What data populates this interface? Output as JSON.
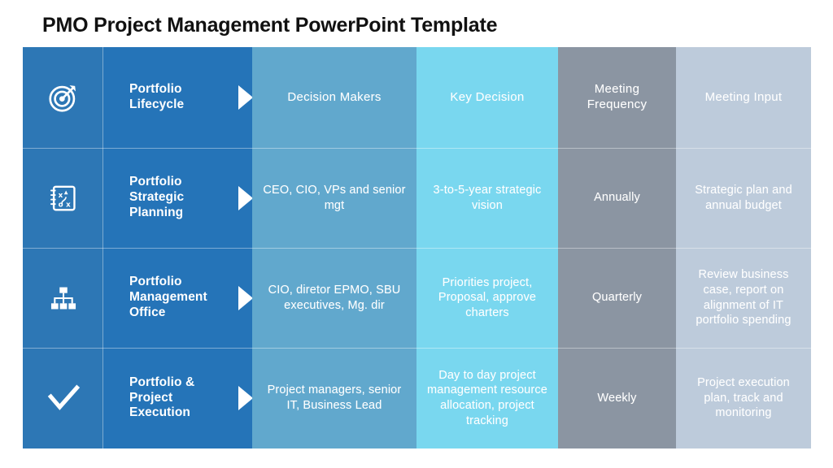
{
  "slide": {
    "title": "PMO Project Management PowerPoint Template"
  },
  "colors": {
    "icon_column": "#2d77b5",
    "stage_column": "#2574b8",
    "column_3": "#61a8cd",
    "column_4": "#79d7ef",
    "column_5": "#8b95a2",
    "column_6": "#bdcbdb",
    "arrow": "#ffffff",
    "title_text": "#111111",
    "cell_text": "#ffffff"
  },
  "matrix": {
    "columns": [
      {
        "key": "icon",
        "header": ""
      },
      {
        "key": "stage",
        "header": "Portfolio Lifecycle"
      },
      {
        "key": "c3",
        "header": "Decision Makers"
      },
      {
        "key": "c4",
        "header": "Key Decision"
      },
      {
        "key": "c5",
        "header": "Meeting Frequency"
      },
      {
        "key": "c6",
        "header": "Meeting Input"
      }
    ],
    "rows": [
      {
        "icon": "target-icon",
        "stage": "Portfolio\nLifecycle",
        "stage_line1": "Portfolio",
        "stage_line2": "Lifecycle",
        "stage_line3": "",
        "decision_makers": "Decision Makers",
        "key_decision": "Key Decision",
        "meeting_frequency": "Meeting\nFrequency",
        "meeting_input": "Meeting Input",
        "is_header": true
      },
      {
        "icon": "strategy-playbook-icon",
        "stage_line1": "Portfolio",
        "stage_line2": "Strategic",
        "stage_line3": "Planning",
        "decision_makers": "CEO, CIO, VPs and senior mgt",
        "key_decision": "3-to-5-year strategic vision",
        "meeting_frequency": "Annually",
        "meeting_input": "Strategic plan and annual budget",
        "is_header": false
      },
      {
        "icon": "org-chart-icon",
        "stage_line1": "Portfolio",
        "stage_line2": "Management",
        "stage_line3": "Office",
        "decision_makers": "CIO, diretor EPMO, SBU executives, Mg. dir",
        "key_decision": "Priorities project, Proposal, approve charters",
        "meeting_frequency": "Quarterly",
        "meeting_input": "Review business case, report on alignment of IT portfolio spending",
        "is_header": false
      },
      {
        "icon": "checkmark-icon",
        "stage_line1": "Portfolio &",
        "stage_line2": "Project",
        "stage_line3": "Execution",
        "decision_makers": "Project managers, senior IT, Business Lead",
        "key_decision": "Day to day project management resource allocation, project tracking",
        "meeting_frequency": "Weekly",
        "meeting_input": "Project execution plan, track and monitoring",
        "is_header": false
      }
    ]
  }
}
